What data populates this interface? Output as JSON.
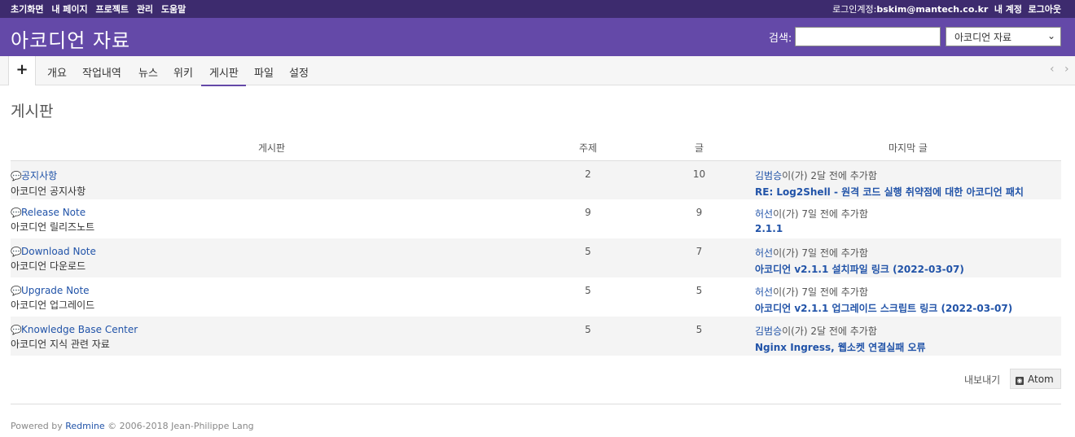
{
  "top_menu": {
    "left_items": [
      "초기화면",
      "내 페이지",
      "프로젝트",
      "관리",
      "도움말"
    ],
    "login_prefix": "로그인계정:",
    "login_user": "bskim@mantech.co.kr",
    "my_account": "내 계정",
    "logout": "로그아웃"
  },
  "header": {
    "title": "아코디언 자료",
    "search_label": "검색:",
    "search_value": "",
    "project_select": "아코디언 자료"
  },
  "tabs": {
    "new": "+",
    "items": [
      "개요",
      "작업내역",
      "뉴스",
      "위키",
      "게시판",
      "파일",
      "설정"
    ],
    "selected": "게시판",
    "scroll_left": "‹",
    "scroll_right": "›"
  },
  "page_title": "게시판",
  "table": {
    "headers": [
      "게시판",
      "주제",
      "글",
      "마지막 글"
    ],
    "rows": [
      {
        "name": "공지사항",
        "desc": "아코디언 공지사항",
        "topics": "2",
        "messages": "10",
        "author": "김범승",
        "when": "이(가) 2달 전에 추가함",
        "last": "RE: Log2Shell - 원격 코드 실행 취약점에 대한 아코디언 패치"
      },
      {
        "name": "Release Note",
        "desc": "아코디언 릴리즈노트",
        "topics": "9",
        "messages": "9",
        "author": "허선",
        "when": "이(가) 7일 전에 추가함",
        "last": "2.1.1"
      },
      {
        "name": "Download Note",
        "desc": "아코디언 다운로드",
        "topics": "5",
        "messages": "7",
        "author": "허선",
        "when": "이(가) 7일 전에 추가함",
        "last": "아코디언 v2.1.1 설치파일 링크 (2022-03-07)"
      },
      {
        "name": "Upgrade Note",
        "desc": "아코디언 업그레이드",
        "topics": "5",
        "messages": "5",
        "author": "허선",
        "when": "이(가) 7일 전에 추가함",
        "last": "아코디언 v2.1.1 업그레이드 스크립트 링크 (2022-03-07)"
      },
      {
        "name": "Knowledge Base Center",
        "desc": "아코디언 지식 관련 자료",
        "topics": "5",
        "messages": "5",
        "author": "김범승",
        "when": "이(가) 2달 전에 추가함",
        "last": "Nginx Ingress, 웹소켓 연결실패 오류"
      }
    ]
  },
  "export": {
    "label": "내보내기",
    "atom": "Atom"
  },
  "footer": {
    "prefix": "Powered by ",
    "link": "Redmine",
    "suffix": " © 2006-2018 Jean-Philippe Lang"
  },
  "colors": {
    "top_bar": "#3d2b6e",
    "header": "#6449a8",
    "link": "#2153a8"
  },
  "icons": {
    "board": "comments-icon",
    "feed": "feed-icon"
  }
}
